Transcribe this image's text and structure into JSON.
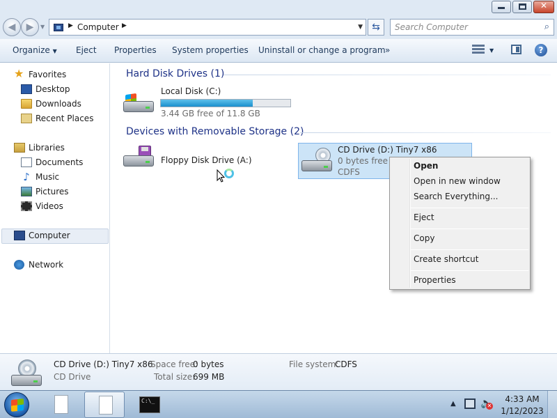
{
  "address": {
    "path": "Computer"
  },
  "search": {
    "placeholder": "Search Computer"
  },
  "toolbar": {
    "organize": "Organize",
    "eject": "Eject",
    "properties": "Properties",
    "system_properties": "System properties",
    "uninstall": "Uninstall or change a program",
    "more": "»"
  },
  "sidebar": {
    "favorites": "Favorites",
    "desktop": "Desktop",
    "downloads": "Downloads",
    "recent_places": "Recent Places",
    "libraries": "Libraries",
    "documents": "Documents",
    "music": "Music",
    "pictures": "Pictures",
    "videos": "Videos",
    "computer": "Computer",
    "network": "Network"
  },
  "main": {
    "hdd_group": "Hard Disk Drives (1)",
    "removable_group": "Devices with Removable Storage (2)",
    "local_disk": {
      "name": "Local Disk (C:)",
      "free": "3.44 GB free of 11.8 GB",
      "used_fraction": 0.71
    },
    "floppy": {
      "name": "Floppy Disk Drive (A:)"
    },
    "cd": {
      "name": "CD Drive (D:) Tiny7 x86",
      "free": "0 bytes free of",
      "fs": "CDFS"
    }
  },
  "context_menu": {
    "open": "Open",
    "open_new_window": "Open in new window",
    "search_everything": "Search Everything...",
    "eject": "Eject",
    "copy": "Copy",
    "create_shortcut": "Create shortcut",
    "properties": "Properties"
  },
  "details": {
    "name": "CD Drive (D:) Tiny7 x86",
    "type": "CD Drive",
    "space_free_label": "Space free:",
    "space_free": "0 bytes",
    "total_size_label": "Total size:",
    "total_size": "699 MB",
    "fs_label": "File system:",
    "fs": "CDFS"
  },
  "taskbar": {
    "cmd_text": "C:\\_",
    "time": "4:33 AM",
    "date": "1/12/2023"
  },
  "icons": {
    "close": "close-icon",
    "maximize": "maximize-icon",
    "minimize": "minimize-icon",
    "search": "search-icon",
    "refresh": "refresh-icon",
    "help": "help-icon"
  }
}
